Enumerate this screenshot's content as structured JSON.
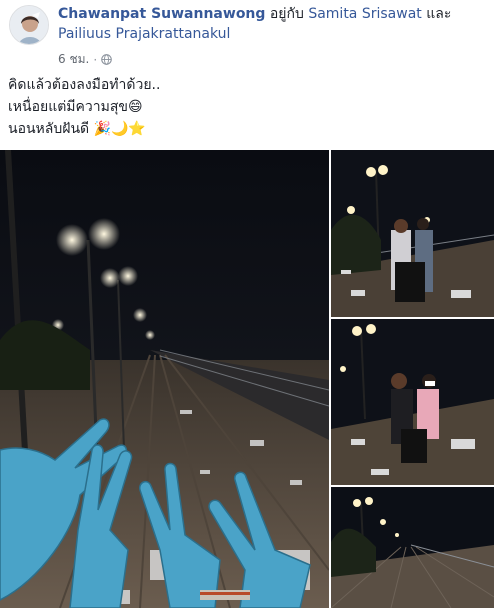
{
  "post": {
    "author": "Chawanpat Suwannawong",
    "with_word": "อยู่กับ",
    "tagged_1": "Samita Srisawat",
    "and_word": "และ",
    "tagged_2": "Pailiuus Prajakrattanakul",
    "time": "6 ชม.",
    "dot": "·",
    "privacy_icon": "globe-icon"
  },
  "text": {
    "line1": "คิดแล้วต้องลงมือทำด้วย..",
    "line2": "เหนื่อยแต่มีความสุข😄",
    "line3": "นอนหลับฝันดี 🎉🌙⭐"
  },
  "photos": {
    "count": 4
  },
  "colors": {
    "link": "#365899",
    "text": "#1d2129",
    "meta": "#616770",
    "glove": "#4aa3c8"
  }
}
